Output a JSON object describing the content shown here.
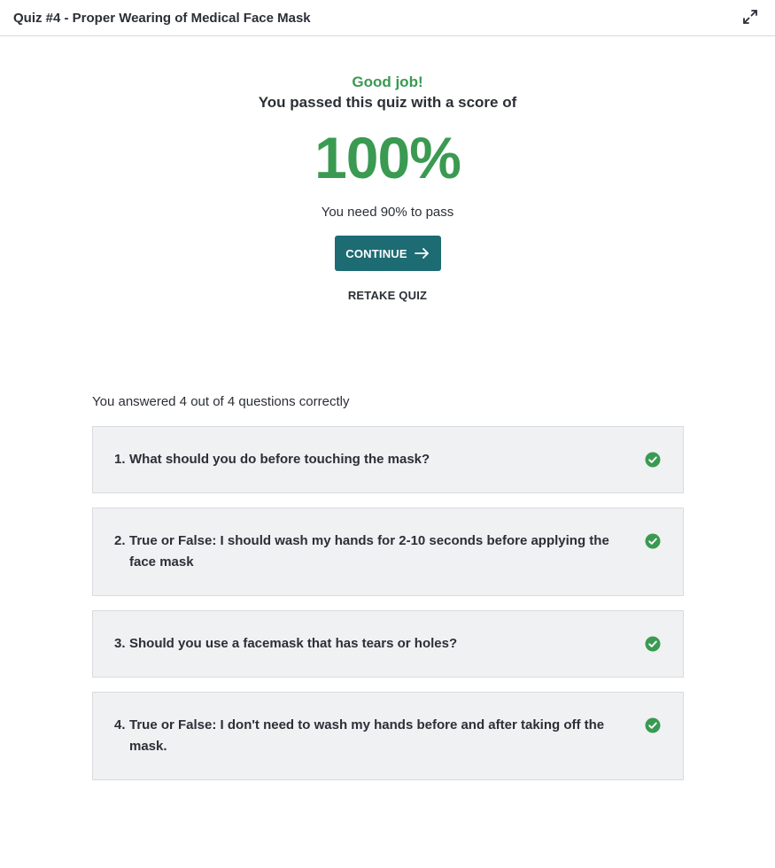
{
  "header": {
    "title": "Quiz #4 - Proper Wearing of Medical Face Mask",
    "expand_icon": "expand-icon"
  },
  "result": {
    "headline": "Good job!",
    "message": "You passed this quiz with a score of",
    "score": "100%",
    "requirement": "You need 90% to pass",
    "continue_label": "CONTINUE",
    "retake_label": "RETAKE QUIZ"
  },
  "summary": "You answered 4 out of 4 questions correctly",
  "questions": [
    {
      "num": "1.",
      "text": "What should you do before touching the mask?",
      "correct": true
    },
    {
      "num": "2.",
      "text": "True or False: I should wash my hands for 2-10 seconds before applying the face mask",
      "correct": true
    },
    {
      "num": "3.",
      "text": "Should you use a facemask that has tears or holes?",
      "correct": true
    },
    {
      "num": "4.",
      "text": "True or False: I don't need to wash my hands before and after taking off the mask.",
      "correct": true
    }
  ],
  "colors": {
    "success": "#3a9a52",
    "primary_button": "#1d6b73",
    "card_bg": "#f0f1f3"
  }
}
